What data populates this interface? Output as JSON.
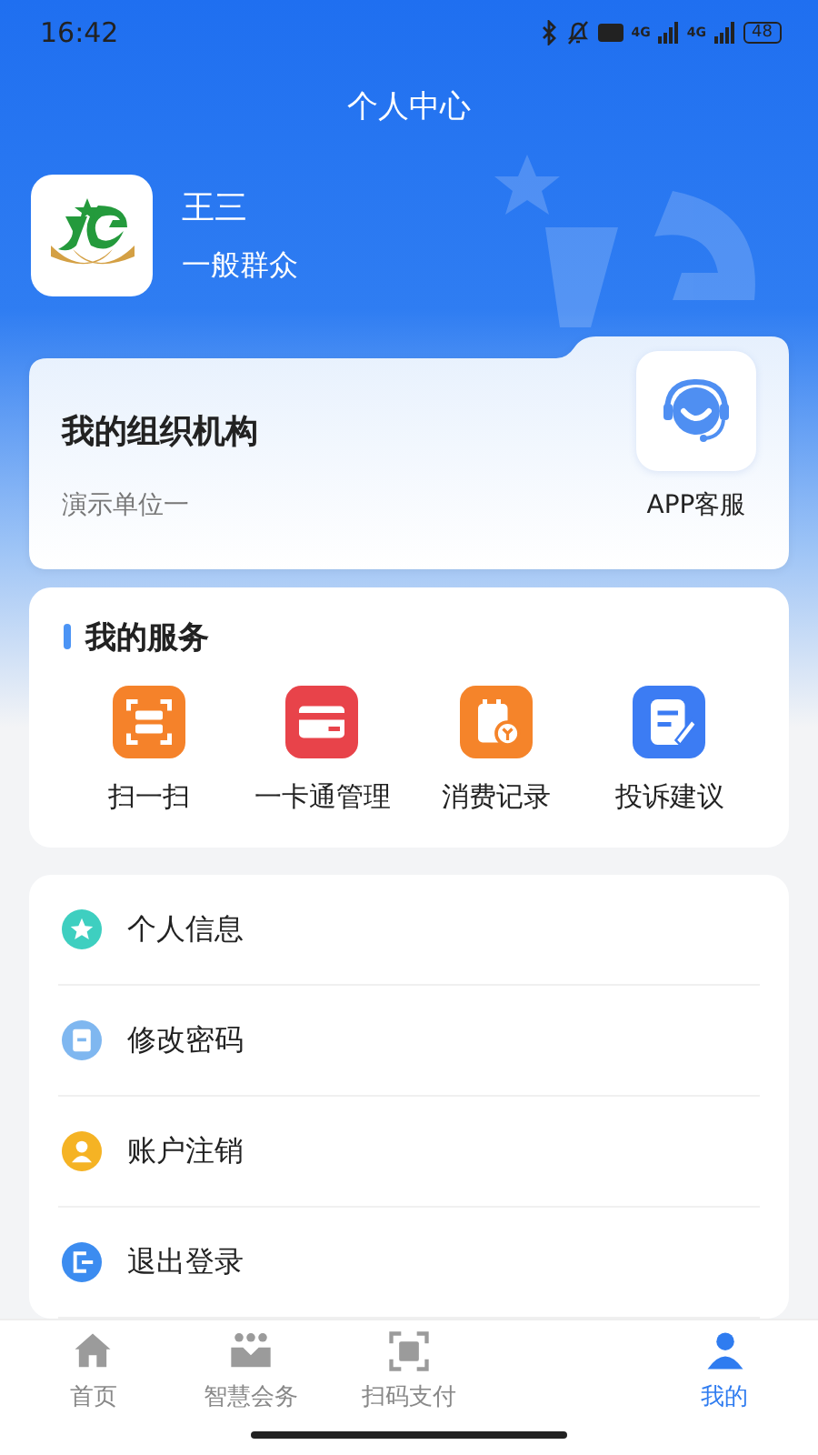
{
  "status_bar": {
    "time": "16:42",
    "network_1": "4G",
    "network_2": "4G",
    "battery": "48"
  },
  "header": {
    "title": "个人中心"
  },
  "profile": {
    "name": "王三",
    "role": "一般群众"
  },
  "organization": {
    "title": "我的组织机构",
    "unit": "演示单位一",
    "support_label": "APP客服"
  },
  "services": {
    "title": "我的服务",
    "items": [
      {
        "label": "扫一扫",
        "kind": "scan",
        "color": "#f5822a"
      },
      {
        "label": "一卡通管理",
        "kind": "card",
        "color": "#e8434a"
      },
      {
        "label": "消费记录",
        "kind": "record",
        "color": "#f5842a"
      },
      {
        "label": "投诉建议",
        "kind": "feedback",
        "color": "#3c7cf3"
      }
    ]
  },
  "menu": [
    {
      "label": "个人信息",
      "kind": "star",
      "color": "#3ecfc0"
    },
    {
      "label": "修改密码",
      "kind": "doc",
      "color": "#7fb7f0"
    },
    {
      "label": "账户注销",
      "kind": "user",
      "color": "#f5b324"
    },
    {
      "label": "退出登录",
      "kind": "exit",
      "color": "#3c8cf0"
    }
  ],
  "tab_bar": [
    {
      "label": "首页",
      "kind": "home",
      "selected": false
    },
    {
      "label": "智慧会务",
      "kind": "meeting",
      "selected": false
    },
    {
      "label": "扫码支付",
      "kind": "scan",
      "selected": false
    },
    {
      "kind": "blank"
    },
    {
      "label": "我的",
      "kind": "person",
      "selected": true
    }
  ]
}
